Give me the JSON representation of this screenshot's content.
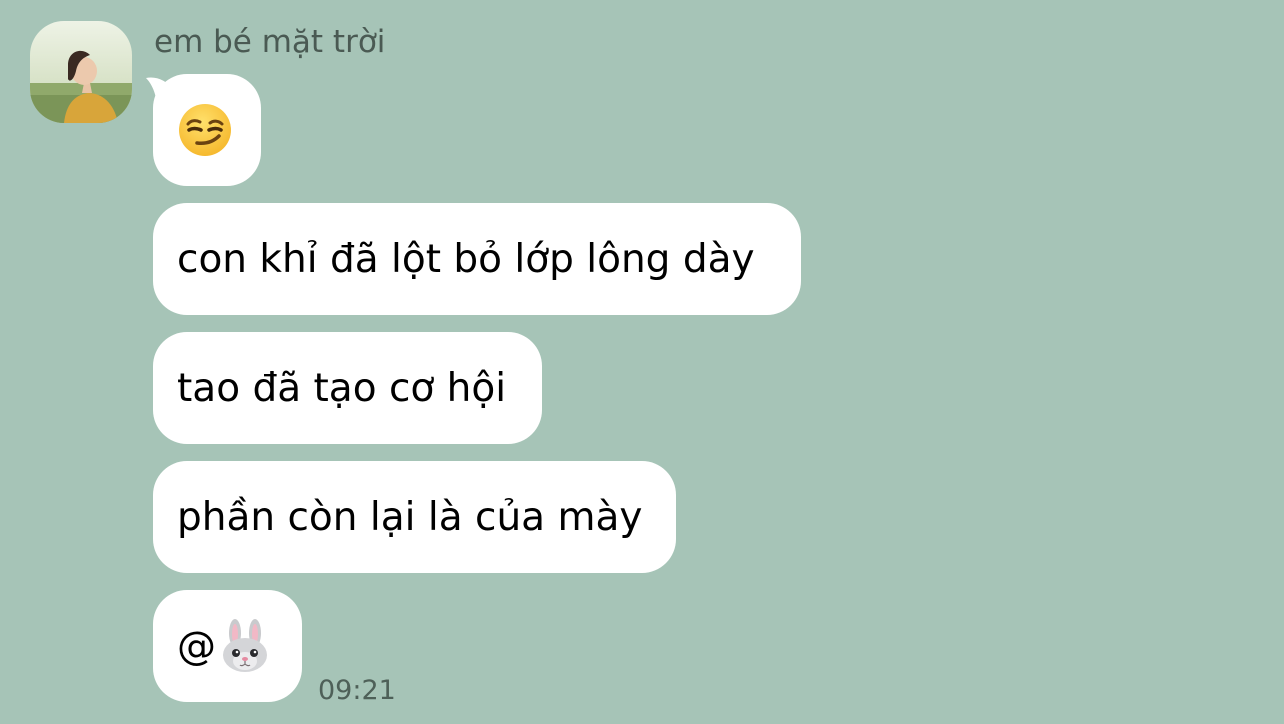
{
  "sender": {
    "name": "em bé mặt trời",
    "avatar_icon": "profile-photo"
  },
  "messages": [
    {
      "kind": "emoji",
      "icon": "smirking-face-emoji"
    },
    {
      "kind": "text",
      "text": "con khỉ đã lột bỏ lớp lông dày"
    },
    {
      "kind": "text",
      "text": "tao đã tạo cơ hội"
    },
    {
      "kind": "text",
      "text": "phần còn lại là của mày"
    },
    {
      "kind": "mention",
      "text": "@",
      "icon": "rabbit-face-emoji"
    }
  ],
  "timestamp": "09:21",
  "colors": {
    "background": "#a6c4b7",
    "bubble": "#ffffff",
    "name_text": "#4a5a53",
    "timestamp_text": "#4e6058"
  }
}
